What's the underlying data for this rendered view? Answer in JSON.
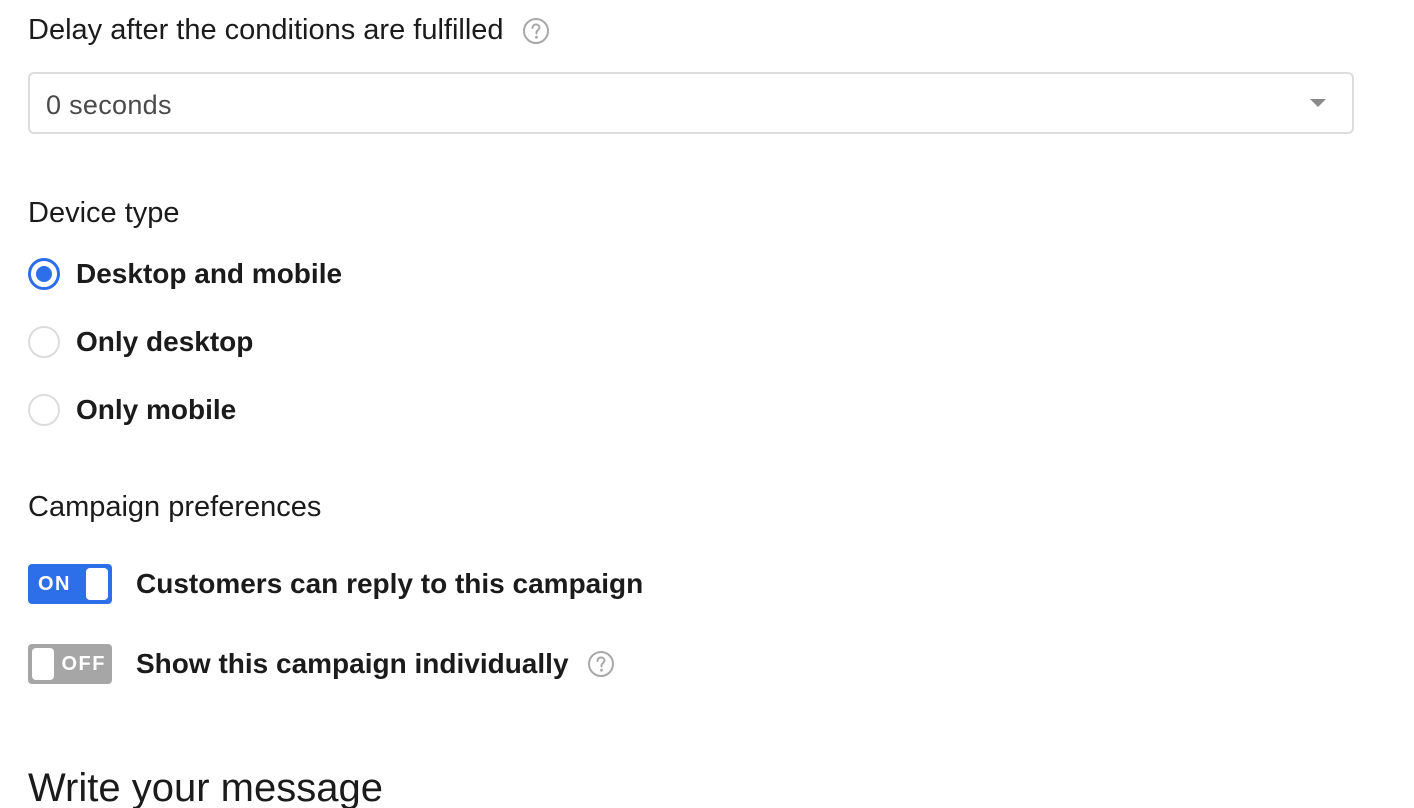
{
  "delay": {
    "label": "Delay after the conditions are fulfilled",
    "help_icon": "question-circle-icon",
    "select_value": "0 seconds",
    "chevron_icon": "chevron-down-icon"
  },
  "device_type": {
    "label": "Device type",
    "options": [
      {
        "label": "Desktop and mobile",
        "checked": true
      },
      {
        "label": "Only desktop",
        "checked": false
      },
      {
        "label": "Only mobile",
        "checked": false
      }
    ]
  },
  "campaign_preferences": {
    "label": "Campaign preferences",
    "toggles": [
      {
        "state_text": "ON",
        "on": true,
        "label": "Customers can reply to this campaign"
      },
      {
        "state_text": "OFF",
        "on": false,
        "label": "Show this campaign individually",
        "help_icon": "question-circle-icon"
      }
    ]
  },
  "message_section": {
    "heading": "Write your message"
  },
  "colors": {
    "accent": "#2d6fe8",
    "toggle_off": "#a6a6a6",
    "border": "#dcdcdc",
    "text": "#1b1b1b"
  }
}
